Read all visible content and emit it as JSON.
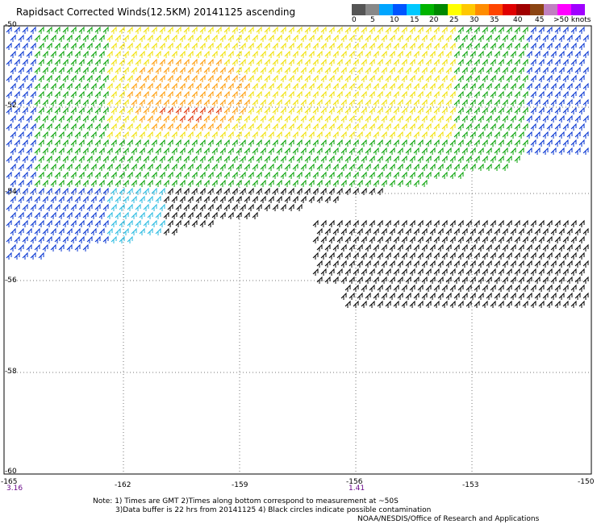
{
  "title": "Rapidsact Corrected Winds(12.5KM) 20141125 ascending",
  "colorbar": {
    "colors": [
      "#555555",
      "#888888",
      "#00a5ff",
      "#0055ff",
      "#00c8ff",
      "#00b400",
      "#008800",
      "#ffff00",
      "#ffc800",
      "#ff8c00",
      "#ff4500",
      "#e00000",
      "#a00000",
      "#8b4513",
      "#c080c0",
      "#ff00ff",
      "#a000ff"
    ],
    "labels": [
      "0",
      "5",
      "10",
      "15",
      "20",
      "25",
      "30",
      "35",
      "40",
      "45",
      ">50 knots"
    ]
  },
  "map": {
    "lon_labels": [
      "-165",
      "-162",
      "-159",
      "-156",
      "-153",
      "-150"
    ],
    "lat_labels": [
      "-50",
      "-52",
      "-54",
      "-56",
      "-58",
      "-60"
    ],
    "time_labels": [
      "3.16",
      "1.41"
    ]
  },
  "notes": [
    "Note: 1) Times are GMT 2)Times along bottom correspond to measurement at ~50S",
    "3)Data buffer is 22 hrs from 20141125 4) Black circles indicate possible contamination",
    "NOAA/NESDIS/Office of Research and Applications"
  ]
}
